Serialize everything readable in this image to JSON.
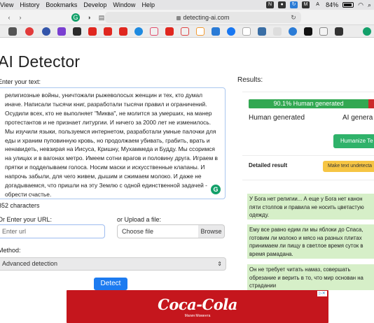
{
  "menubar": {
    "items": [
      "View",
      "History",
      "Bookmarks",
      "Develop",
      "Window",
      "Help"
    ],
    "battery": "84%"
  },
  "browser": {
    "url": "detecting-ai.com"
  },
  "page": {
    "title": "AI Detector",
    "text_label": "Enter your text:",
    "text_content": "религиозные войны, уничтожали рыжеволосых женщин и тех, кто думал иначе. Написали тысячи книг, разработали тысячи правил и ограничений. Осудили всех, кто не выполняет \"Миква\", не молится за умерших, на манер протестантов и не признает литургии. И ничего за 2000 лет не изменилось. Мы изучили языки, пользуемся интернетом, разработали умные палочки для еды и храним пуповинную кровь, но продолжаем убивать, грабить, врать и ненавидеть, невзирая на Иисуса, Кришну, Мухаммеда и Будду. Мы ссоримся на улицах и в вагонах метро. Имеем сотни врагов и половину друга. Играем в прятки и подделываем голоса. Носим маски и искусственные клапаны. И напрочь забыли, для чего живем, дышим и сжимаем молоко. И даже не догадываемся, что пришли на эту Землю с одной единственной задачей - обрести счастье.",
    "char_count": "352 characters",
    "url_label": "Or Enter your URL:",
    "url_placeholder": "Enter url",
    "upload_label": "or Upload a file:",
    "choose_file": "Choose file",
    "browse": "Browse",
    "method_label": "Method:",
    "method_selected": "Advanced detection",
    "detect_button": "Detect"
  },
  "results": {
    "title": "Results:",
    "human_percent": "90.1% Human generated",
    "human_fraction": 0.901,
    "ai_percent_fragment": "9",
    "human_label": "Human generated",
    "ai_label": "AI genera",
    "humanize_button": "Humanize Te",
    "detailed_label": "Detailed result",
    "undetectable_button": "Make text undetecta",
    "paragraphs": [
      "У Бога нет религии... А еще у Бога нет канон пяти столпов и правила не носить цветастую одежду.",
      "Ему все равно едим ли мы яблоки до Спаса, готовим ли молоко и мясо на разных плитах принимаем ли пищу в светлое время суток в время рамадана.",
      "Он не требует читать намаз, совершать обрезание и верить в то, что мир основан на страдании"
    ]
  },
  "ad": {
    "brand": "Coca-Cola",
    "tagline": "Магия Момента"
  },
  "colors": {
    "human_green": "#32a852",
    "ai_red": "#cc2a2a",
    "detect_blue": "#1d7bf0",
    "highlight_green": "#d6efc8"
  }
}
